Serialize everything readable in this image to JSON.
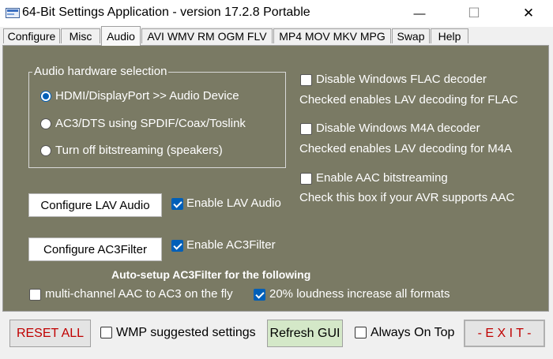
{
  "window": {
    "title": "64-Bit Settings Application - version 17.2.8 Portable",
    "minimize_glyph": "—",
    "maximize_glyph": "☐",
    "close_glyph": "✕"
  },
  "tabs": [
    {
      "label": "Configure"
    },
    {
      "label": "Misc"
    },
    {
      "label": "Audio",
      "active": true
    },
    {
      "label": "AVI WMV RM OGM FLV"
    },
    {
      "label": "MP4 MOV MKV MPG"
    },
    {
      "label": "Swap"
    },
    {
      "label": "Help"
    }
  ],
  "audio": {
    "hardware_group": {
      "label": "Audio hardware selection",
      "options": [
        {
          "label": "HDMI/DisplayPort >> Audio Device",
          "selected": true
        },
        {
          "label": "AC3/DTS using SPDIF/Coax/Toslink",
          "selected": false
        },
        {
          "label": "Turn off bitstreaming (speakers)",
          "selected": false
        }
      ]
    },
    "flac": {
      "label": "Disable Windows FLAC decoder",
      "checked": false,
      "note": "Checked enables LAV decoding for FLAC"
    },
    "m4a": {
      "label": "Disable Windows M4A decoder",
      "checked": false,
      "note": "Checked enables LAV decoding for M4A"
    },
    "aac_bitstream": {
      "label": "Enable AAC bitstreaming",
      "checked": false,
      "note": "Check this box if your AVR supports AAC"
    },
    "configure_lav_label": "Configure LAV Audio",
    "enable_lav": {
      "label": "Enable LAV Audio",
      "checked": true
    },
    "configure_ac3_label": "Configure AC3Filter",
    "enable_ac3": {
      "label": "Enable AC3Filter",
      "checked": true
    },
    "autosetup_heading": "Auto-setup AC3Filter for the following",
    "multichannel": {
      "label": "multi-channel AAC to AC3 on the fly",
      "checked": false
    },
    "loudness": {
      "label": "20% loudness increase all formats",
      "checked": true
    }
  },
  "bottom": {
    "reset_label": "RESET ALL",
    "wmp": {
      "label": "WMP suggested settings",
      "checked": false
    },
    "refresh_label": "Refresh GUI",
    "always_on_top": {
      "label": "Always On Top",
      "checked": false
    },
    "exit_label": "- E X I T -"
  },
  "colors": {
    "panel": "#7a7a64",
    "accent": "#005fb8",
    "reset_text": "#c00000",
    "exit_text": "#c00000",
    "refresh_bg": "#d4e8c8"
  }
}
